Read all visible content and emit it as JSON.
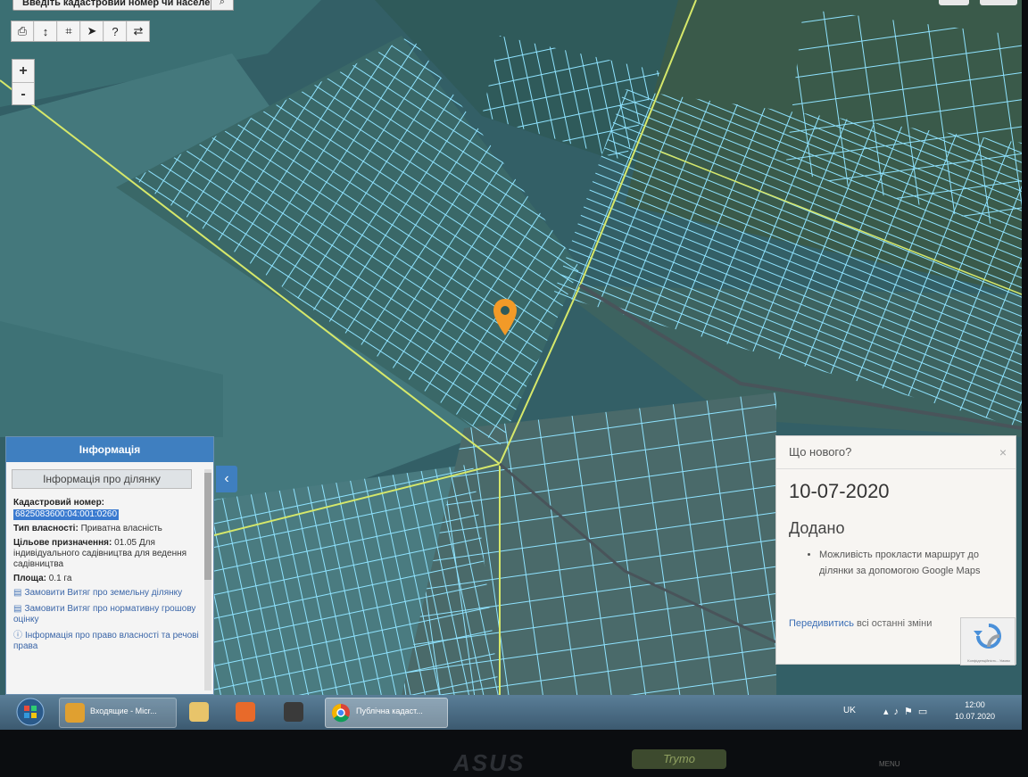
{
  "search": {
    "placeholder": "Введіть кадастровий номер чи населе",
    "button_icon": "search-icon"
  },
  "toolbar": {
    "items": [
      "print-icon",
      "measure-icon",
      "measure-area-icon",
      "cursor-icon",
      "info-icon",
      "route-icon"
    ]
  },
  "zoom": {
    "in_label": "+",
    "out_label": "-"
  },
  "info_panel": {
    "header": "Інформація",
    "subheader": "Інформація про ділянку",
    "cadastral_label": "Кадастровий номер:",
    "cadastral_value": "6825083600:04:001:0260",
    "ownership_label": "Тип власності:",
    "ownership_value": "Приватна власність",
    "purpose_label": "Цільове призначення:",
    "purpose_value": "01.05 Для індивідуального садівництва для ведення садівництва",
    "area_label": "Площа:",
    "area_value": "0.1 га",
    "links": [
      "Замовити Витяг про земельну ділянку",
      "Замовити Витяг про нормативну грошову оцінку",
      "Інформація про право власності та речові права"
    ]
  },
  "news": {
    "title": "Що нового?",
    "close": "×",
    "date": "10-07-2020",
    "added": "Додано",
    "items": [
      "Можливість прокласти маршрут до ділянки за допомогою Google Maps"
    ],
    "link_text": "Передивитись",
    "link_suffix": "всі останні зміни"
  },
  "taskbar": {
    "item1": "Входящие - Micr...",
    "item5": "Публічна кадаст...",
    "lang": "UK",
    "time": "12:00",
    "date": "10.07.2020"
  },
  "bezel": {
    "brand": "ASUS",
    "badge": "Trymo",
    "menu": "MENU"
  },
  "colors": {
    "accent": "#3f7fc0",
    "parcel_lines": "#8fe3ff",
    "marker": "#f29a28"
  }
}
